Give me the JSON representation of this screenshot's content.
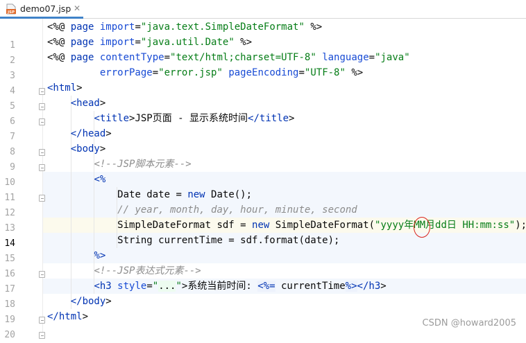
{
  "tab": {
    "title": "demo07.jsp",
    "icon_label": "JSP",
    "close_glyph": "✕"
  },
  "editor": {
    "current_line": 14,
    "lines": [
      {
        "n": "1",
        "tokens": [
          [
            "t-jsp",
            "<%@ "
          ],
          [
            "t-kw",
            "page "
          ],
          [
            "t-attr",
            "import"
          ],
          [
            "t-jsp",
            "="
          ],
          [
            "t-str",
            "\"java.text.SimpleDateFormat\""
          ],
          [
            "t-jsp",
            " %>"
          ]
        ]
      },
      {
        "n": "2",
        "tokens": [
          [
            "t-jsp",
            "<%@ "
          ],
          [
            "t-kw",
            "page "
          ],
          [
            "t-attr",
            "import"
          ],
          [
            "t-jsp",
            "="
          ],
          [
            "t-str",
            "\"java.util.Date\""
          ],
          [
            "t-jsp",
            " %>"
          ]
        ]
      },
      {
        "n": "3",
        "tokens": [
          [
            "t-jsp",
            "<%@ "
          ],
          [
            "t-kw",
            "page "
          ],
          [
            "t-attr",
            "contentType"
          ],
          [
            "t-jsp",
            "="
          ],
          [
            "t-str",
            "\"text/html;charset=UTF-8\""
          ],
          [
            "t-jsp",
            " "
          ],
          [
            "t-attr",
            "language"
          ],
          [
            "t-jsp",
            "="
          ],
          [
            "t-str",
            "\"java\""
          ]
        ]
      },
      {
        "n": "4",
        "tokens": [
          [
            "t-jsp",
            "         "
          ],
          [
            "t-attr",
            "errorPage"
          ],
          [
            "t-jsp",
            "="
          ],
          [
            "t-str",
            "\"error.jsp\""
          ],
          [
            "t-jsp",
            " "
          ],
          [
            "t-attr",
            "pageEncoding"
          ],
          [
            "t-jsp",
            "="
          ],
          [
            "t-str",
            "\"UTF-8\""
          ],
          [
            "t-jsp",
            " %>"
          ]
        ]
      },
      {
        "n": "5",
        "tokens": [
          [
            "t-tag",
            "<html"
          ],
          [
            "t-jsp",
            ">"
          ]
        ]
      },
      {
        "n": "6",
        "tokens": [
          [
            "t-jsp",
            "    "
          ],
          [
            "t-tag",
            "<head"
          ],
          [
            "t-jsp",
            ">"
          ]
        ]
      },
      {
        "n": "7",
        "tokens": [
          [
            "t-jsp",
            "        "
          ],
          [
            "t-tag",
            "<title"
          ],
          [
            "t-jsp",
            ">"
          ],
          [
            "t-text",
            "JSP页面 - 显示系统时间"
          ],
          [
            "t-tag",
            "</title"
          ],
          [
            "t-jsp",
            ">"
          ]
        ]
      },
      {
        "n": "8",
        "tokens": [
          [
            "t-jsp",
            "    "
          ],
          [
            "t-tag",
            "</head"
          ],
          [
            "t-jsp",
            ">"
          ]
        ]
      },
      {
        "n": "9",
        "tokens": [
          [
            "t-jsp",
            "    "
          ],
          [
            "t-tag",
            "<body"
          ],
          [
            "t-jsp",
            ">"
          ]
        ]
      },
      {
        "n": "10",
        "tokens": [
          [
            "t-jsp",
            "        "
          ],
          [
            "t-cmt",
            "<!--JSP脚本元素-->"
          ]
        ]
      },
      {
        "n": "11",
        "tokens": [
          [
            "t-jsp",
            "        "
          ],
          [
            "t-kw",
            "<%"
          ]
        ]
      },
      {
        "n": "12",
        "tokens": [
          [
            "t-jsp",
            "            "
          ],
          [
            "t-text",
            "Date date = "
          ],
          [
            "t-kw",
            "new "
          ],
          [
            "t-text",
            "Date();"
          ]
        ]
      },
      {
        "n": "13",
        "tokens": [
          [
            "t-jsp",
            "            "
          ],
          [
            "t-cmt",
            "// year, month, day, hour, minute, second"
          ]
        ]
      },
      {
        "n": "14",
        "tokens": [
          [
            "t-jsp",
            "            "
          ],
          [
            "t-text",
            "SimpleDateFormat sdf = "
          ],
          [
            "t-kw",
            "new "
          ],
          [
            "t-text",
            "SimpleDateFormat("
          ],
          [
            "t-str",
            "\"yyyy年MM月dd日 HH:mm:ss\""
          ],
          [
            "t-text",
            ");"
          ]
        ]
      },
      {
        "n": "15",
        "tokens": [
          [
            "t-jsp",
            "            "
          ],
          [
            "t-text",
            "String currentTime = sdf.format(date);"
          ]
        ]
      },
      {
        "n": "16",
        "tokens": [
          [
            "t-jsp",
            "        "
          ],
          [
            "t-kw",
            "%>"
          ]
        ]
      },
      {
        "n": "17",
        "tokens": [
          [
            "t-jsp",
            "        "
          ],
          [
            "t-cmt",
            "<!--JSP表达式元素-->"
          ]
        ]
      },
      {
        "n": "18",
        "tokens": [
          [
            "t-jsp",
            "        "
          ],
          [
            "t-tag",
            "<h3 "
          ],
          [
            "t-attr",
            "style"
          ],
          [
            "t-jsp",
            "="
          ],
          [
            "t-str",
            "\""
          ],
          [
            "t-bg",
            "..."
          ],
          [
            "t-str",
            "\""
          ],
          [
            "t-jsp",
            ">"
          ],
          [
            "t-text",
            "系统当前时间: "
          ],
          [
            "t-sdelim",
            "<%="
          ],
          [
            "t-text",
            " currentTime"
          ],
          [
            "t-sdelim",
            "%>"
          ],
          [
            "t-tag",
            "</h3"
          ],
          [
            "t-jsp",
            ">"
          ]
        ]
      },
      {
        "n": "19",
        "tokens": [
          [
            "t-jsp",
            "    "
          ],
          [
            "t-tag",
            "</body"
          ],
          [
            "t-jsp",
            ">"
          ]
        ]
      },
      {
        "n": "20",
        "tokens": [
          [
            "t-tag",
            "</html"
          ],
          [
            "t-jsp",
            ">"
          ]
        ]
      }
    ]
  },
  "watermark": "CSDN @howard2005",
  "colors": {
    "accent_tab_underline": "#4083c9",
    "annotation_circle": "#d9251f"
  }
}
